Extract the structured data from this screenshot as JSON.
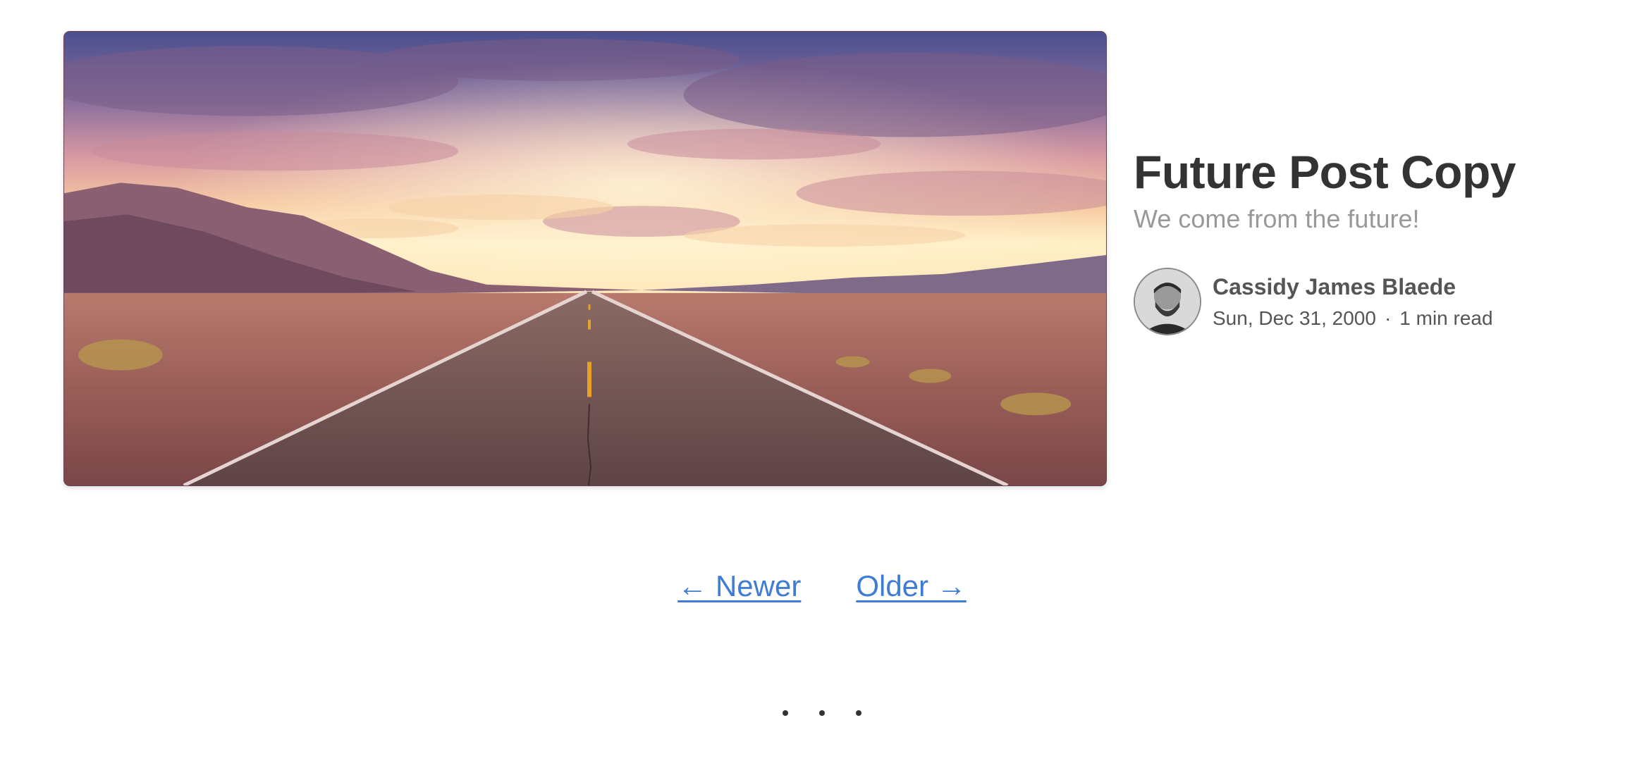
{
  "hero": {
    "image_alt": "desert road at sunset",
    "colors": {
      "sky_top": "#4b4f8c",
      "sky_mid": "#d69aa3",
      "horizon": "#ffe8b8",
      "ground": "#9a5e5a",
      "road": "#6b5050",
      "center_line": "#e6a22a"
    }
  },
  "post": {
    "title": "Future Post Copy",
    "subtitle": "We come from the future!"
  },
  "author": {
    "name": "Cassidy James Blaede",
    "date": "Sun, Dec 31, 2000",
    "separator": "·",
    "read_time": "1 min read",
    "avatar_icon": "author-avatar"
  },
  "pager": {
    "newer_label": "← Newer",
    "older_label": "Older →"
  },
  "colors": {
    "link": "#3f7cd4",
    "title": "#333333",
    "subtitle": "#999999",
    "meta": "#555555"
  }
}
